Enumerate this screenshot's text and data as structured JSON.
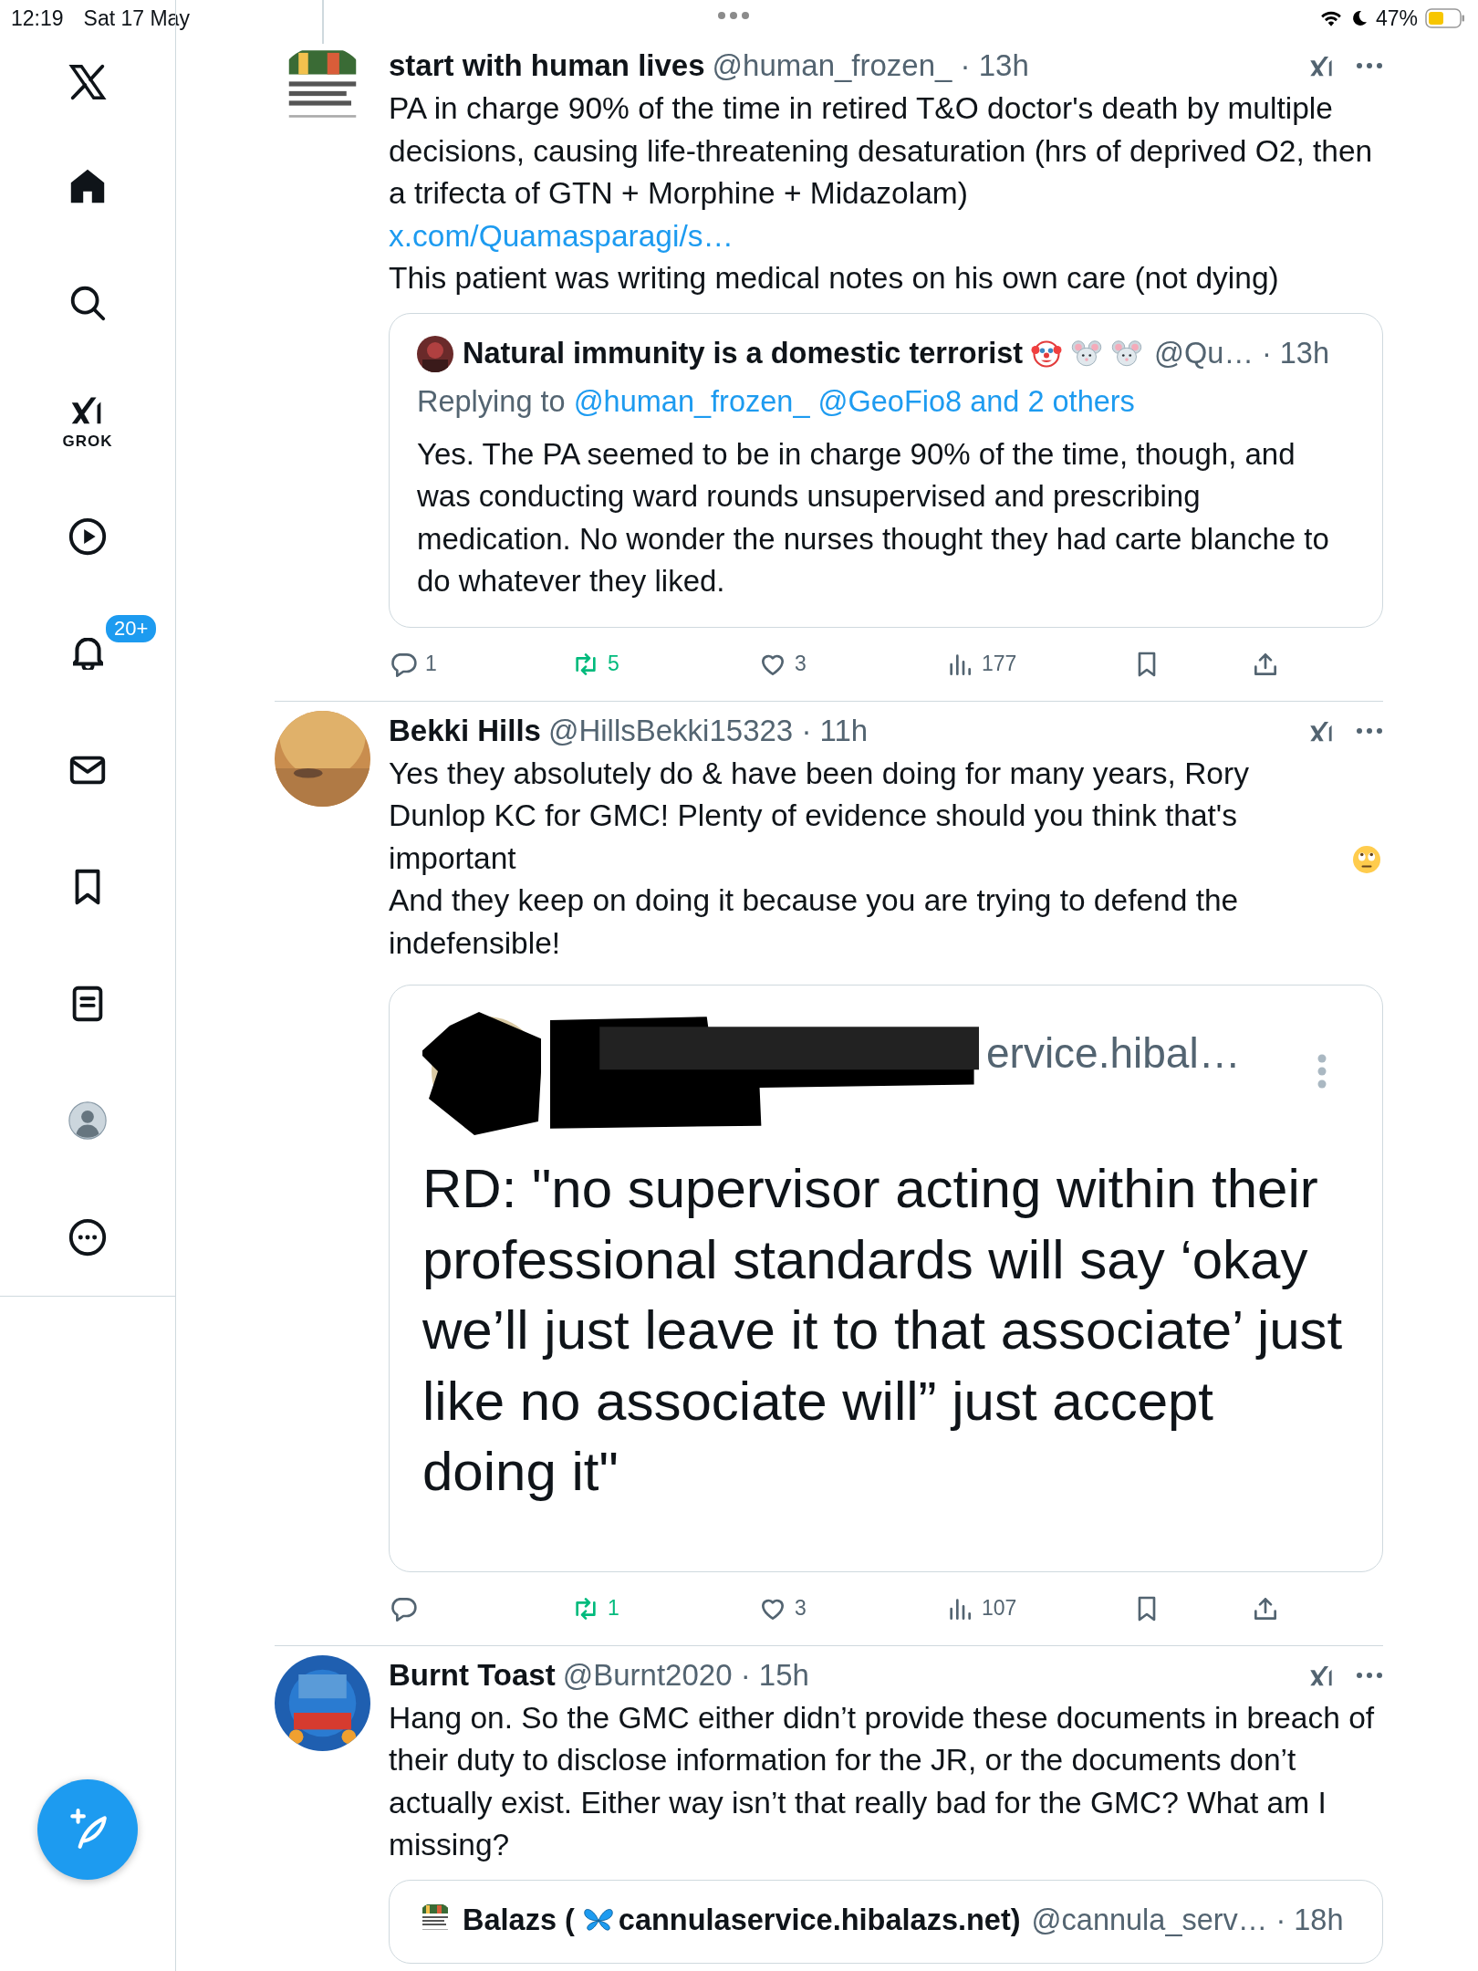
{
  "status_bar": {
    "time": "12:19",
    "date": "Sat 17 May",
    "battery": "47%"
  },
  "sidebar": {
    "items": [
      {
        "kind": "x"
      },
      {
        "kind": "home"
      },
      {
        "kind": "search"
      },
      {
        "kind": "grok",
        "label": "GROK"
      },
      {
        "kind": "video"
      },
      {
        "kind": "notifications",
        "badge": "20+"
      },
      {
        "kind": "messages"
      },
      {
        "kind": "bookmarks"
      },
      {
        "kind": "lists"
      },
      {
        "kind": "profile"
      },
      {
        "kind": "more"
      }
    ]
  },
  "tweets": [
    {
      "name": "start with human lives",
      "handle": "@human_frozen_",
      "time": "· 13h",
      "body": [
        [
          {
            "kind": "text",
            "text": "PA in charge 90% of the time in retired T&O doctor's death by multiple decisions, causing life-threatening desaturation (hrs of deprived O2, then a trifecta of GTN + Morphine + Midazolam)"
          }
        ],
        [
          {
            "kind": "link",
            "text": "x.com/Quamasparagi/s…"
          }
        ],
        [
          {
            "kind": "text",
            "text": "This patient was writing medical notes on his own care (not dying)"
          }
        ]
      ],
      "quote": {
        "kind": "post",
        "name": [
          {
            "kind": "text",
            "text": "Natural immunity is a domestic terrorist"
          },
          {
            "kind": "clown"
          },
          {
            "kind": "mouse"
          },
          {
            "kind": "mouse"
          }
        ],
        "handle": "@Qu…",
        "time": "· 13h",
        "replying": {
          "label": "Replying to",
          "links": [
            "@human_frozen_",
            "@GeoFio8 and 2 others"
          ]
        },
        "body": "Yes. The PA seemed to be in charge 90% of the time, though, and was conducting ward rounds unsupervised and prescribing medication. No wonder the nurses thought they had carte blanche to do whatever they liked."
      },
      "actions": {
        "replies": "1",
        "reposts": "5",
        "reposted": true,
        "likes": "3",
        "liked": false,
        "views": "177"
      }
    },
    {
      "name": "Bekki Hills",
      "handle": "@HillsBekki15323",
      "time": "· 11h",
      "body": [
        [
          {
            "kind": "text",
            "text": "Yes they absolutely do & have been doing for many years, Rory Dunlop KC for GMC! Plenty of evidence should you think that's important"
          },
          {
            "kind": "eye-roll"
          }
        ],
        [
          {
            "kind": "text",
            "text": "And they keep on doing it because you are trying to defend the indefensible!"
          }
        ]
      ],
      "quote": {
        "kind": "screenshot",
        "visible_name": "ervice.hibal…",
        "text": "RD: \"no supervisor acting within their professional standards will say ‘okay we’ll just leave it to that associate’ just like no associate will” just accept doing it\""
      },
      "actions": {
        "reposts": "1",
        "reposted": true,
        "likes": "3",
        "liked": false,
        "views": "107"
      }
    },
    {
      "name": "Burnt Toast",
      "handle": "@Burnt2020",
      "time": "· 15h",
      "body": [
        [
          {
            "kind": "text",
            "text": "Hang on. So the GMC either didn’t provide these documents in breach of their duty to disclose information for the JR, or the documents don’t actually exist. Either way isn’t that really bad for the GMC? What am I missing?"
          }
        ]
      ],
      "quote": {
        "kind": "post",
        "name": [
          {
            "kind": "text",
            "text": "Balazs ("
          },
          {
            "kind": "butterfly"
          },
          {
            "kind": "text",
            "text": "cannulaservice.hibalazs.net)"
          }
        ],
        "handle": "@cannula_serv…",
        "time": "· 18h"
      }
    }
  ]
}
